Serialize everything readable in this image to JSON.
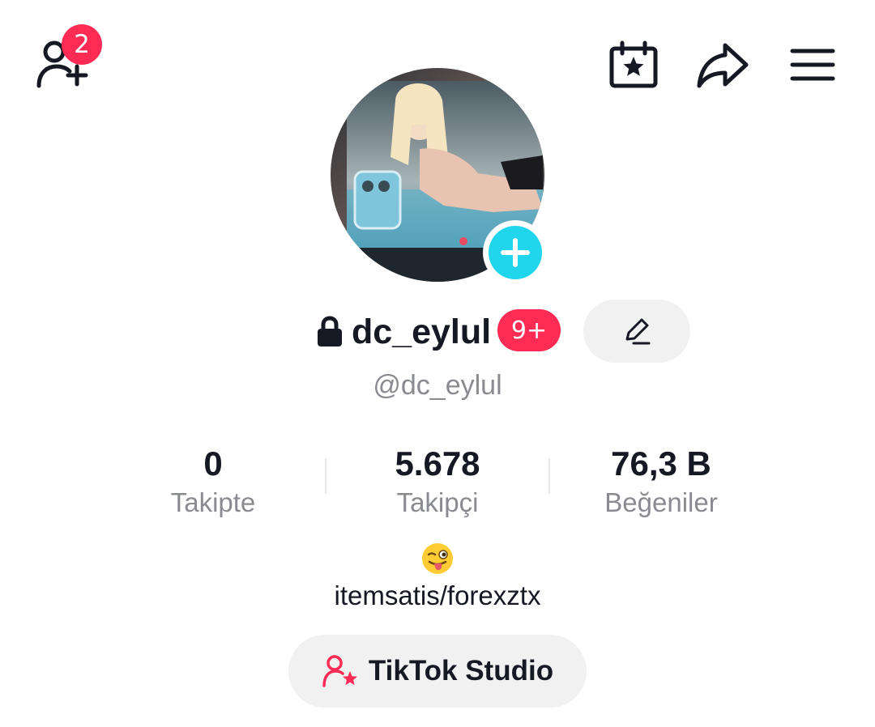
{
  "header": {
    "add_friends_icon": "person-plus-icon",
    "add_friends_count": "2",
    "calendar_icon": "calendar-star-icon",
    "share_icon": "share-arrow-icon",
    "menu_icon": "hamburger-menu-icon"
  },
  "profile": {
    "display_name": "dc_eylul",
    "notification_badge": "9+",
    "username": "@dc_eylul",
    "private": true,
    "accent_color": "#fe2c55",
    "add_color": "#20d5ec"
  },
  "stats": [
    {
      "value": "0",
      "label": "Takipte"
    },
    {
      "value": "5.678",
      "label": "Takipçi"
    },
    {
      "value": "76,3 B",
      "label": "Beğeniler"
    }
  ],
  "bio": {
    "emoji": "winking-face-with-tongue",
    "text": "itemsatis/forexztx"
  },
  "studio": {
    "label": "TikTok Studio",
    "icon": "person-star-icon"
  }
}
